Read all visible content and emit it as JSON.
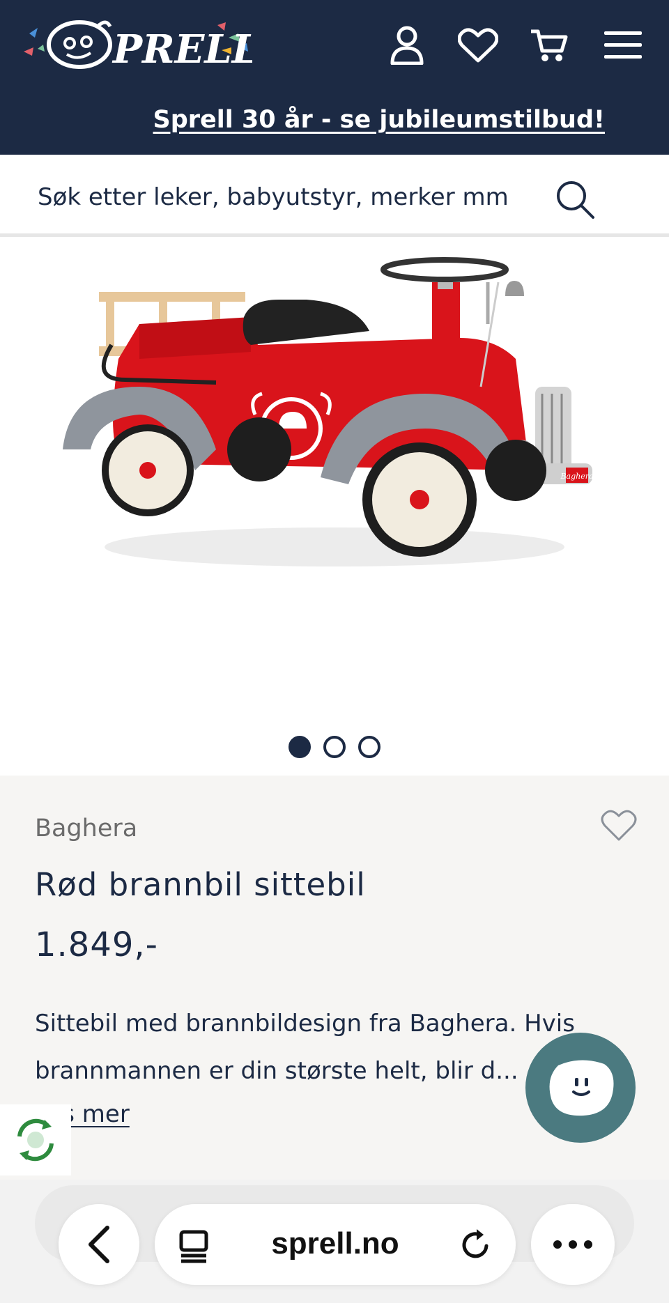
{
  "header": {
    "logo_text": "SPRELL",
    "icons": [
      "user-icon",
      "heart-icon",
      "cart-icon",
      "menu-icon"
    ]
  },
  "promo": {
    "text": "Sprell 30 år - se jubileumstilbud!"
  },
  "search": {
    "placeholder": "Søk etter leker, babyutstyr, merker mm"
  },
  "gallery": {
    "slides": 3,
    "active_slide": 1
  },
  "product": {
    "brand": "Baghera",
    "title": "Rød brannbil sittebil",
    "price": "1.849,-",
    "description": "Sittebil med brannbildesign fra Baghera. Hvis brannmannen er din største helt, blir d...",
    "read_more": "Les mer",
    "car_plate": "Baghera"
  },
  "browser": {
    "url": "sprell.no"
  },
  "colors": {
    "navy": "#1c2a44",
    "panel": "#f6f5f3",
    "chat": "#4b7a80",
    "car_red": "#d9141b"
  }
}
